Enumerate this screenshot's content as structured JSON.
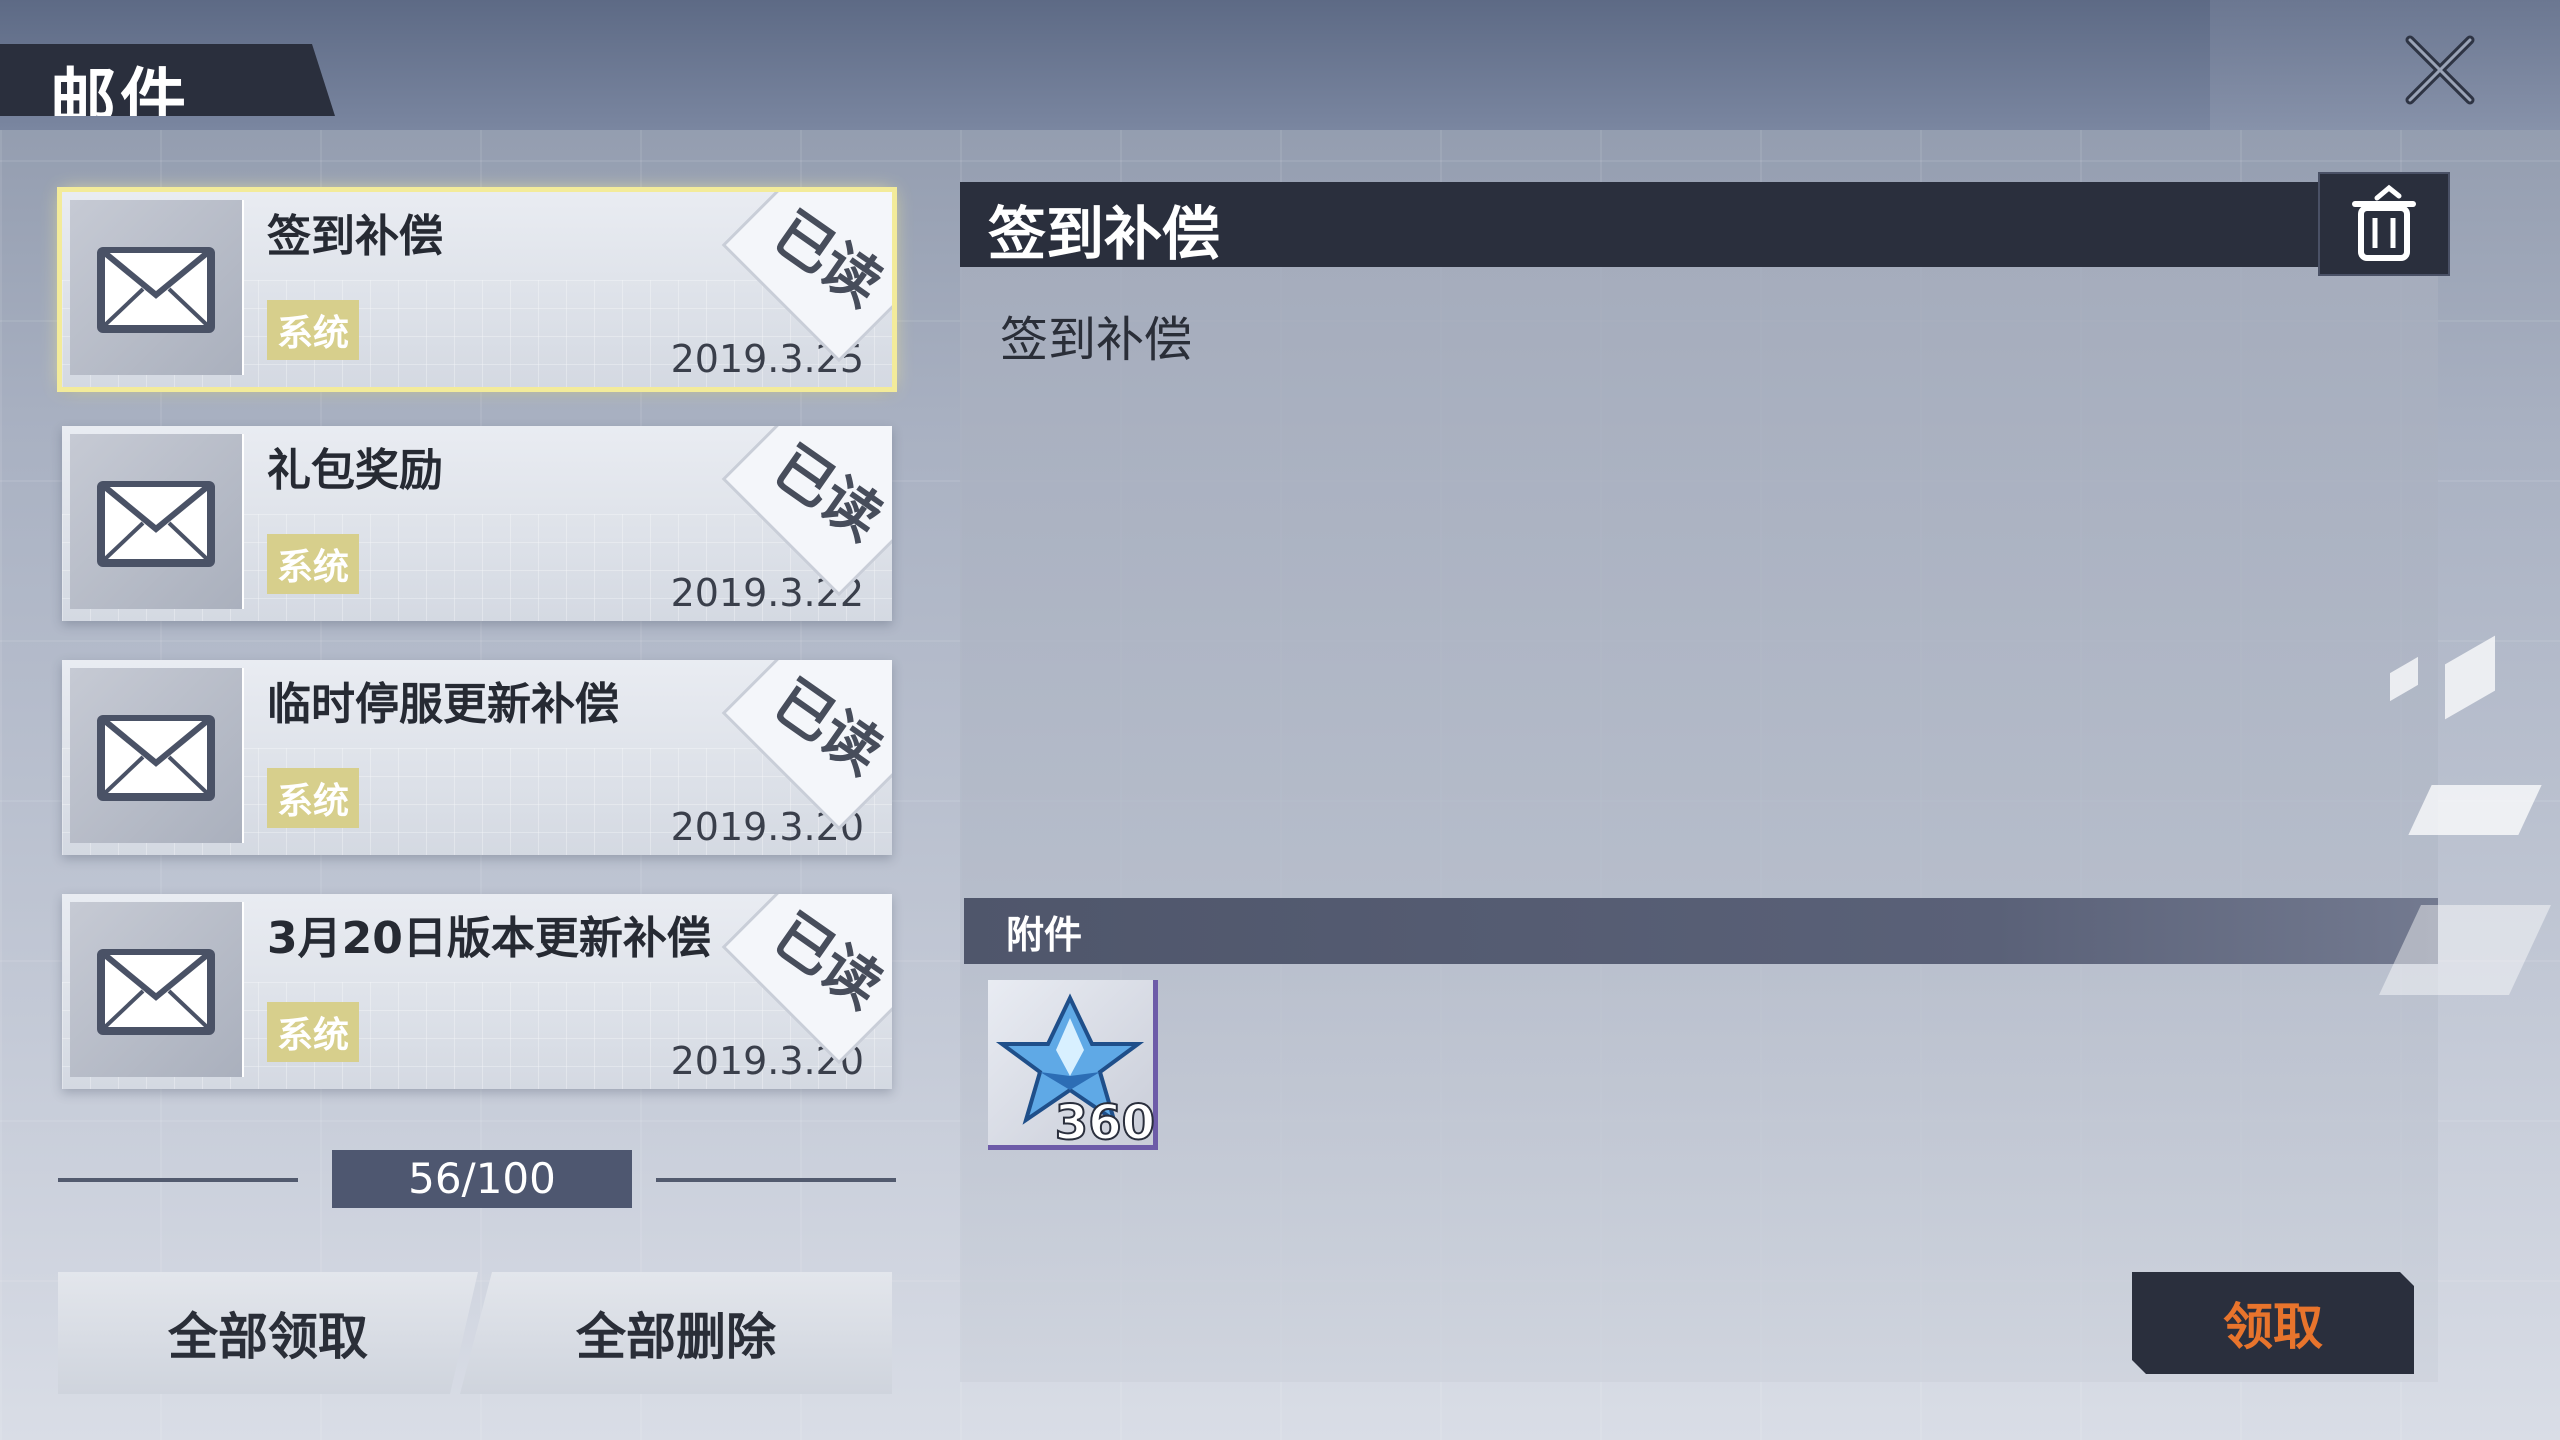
{
  "header": {
    "title": "邮件"
  },
  "mails": [
    {
      "title": "签到补偿",
      "tag": "系统",
      "date": "2019.3.25",
      "stamp": "已读"
    },
    {
      "title": "礼包奖励",
      "tag": "系统",
      "date": "2019.3.22",
      "stamp": "已读"
    },
    {
      "title": "临时停服更新补偿",
      "tag": "系统",
      "date": "2019.3.20",
      "stamp": "已读"
    },
    {
      "title": "3月20日版本更新补偿",
      "tag": "系统",
      "date": "2019.3.20",
      "stamp": "已读"
    }
  ],
  "counter": "56/100",
  "actions": {
    "claim_all": "全部领取",
    "delete_all": "全部删除"
  },
  "detail": {
    "title": "签到补偿",
    "body": "签到补偿",
    "attachment_label": "附件",
    "attachment": {
      "icon": "crystal-star-icon",
      "count": "360"
    },
    "claim_label": "领取"
  },
  "colors": {
    "accent": "#e8742c",
    "dark": "#2a2f3d",
    "tag": "#d7cf8c",
    "selected": "#f3eb9a"
  }
}
